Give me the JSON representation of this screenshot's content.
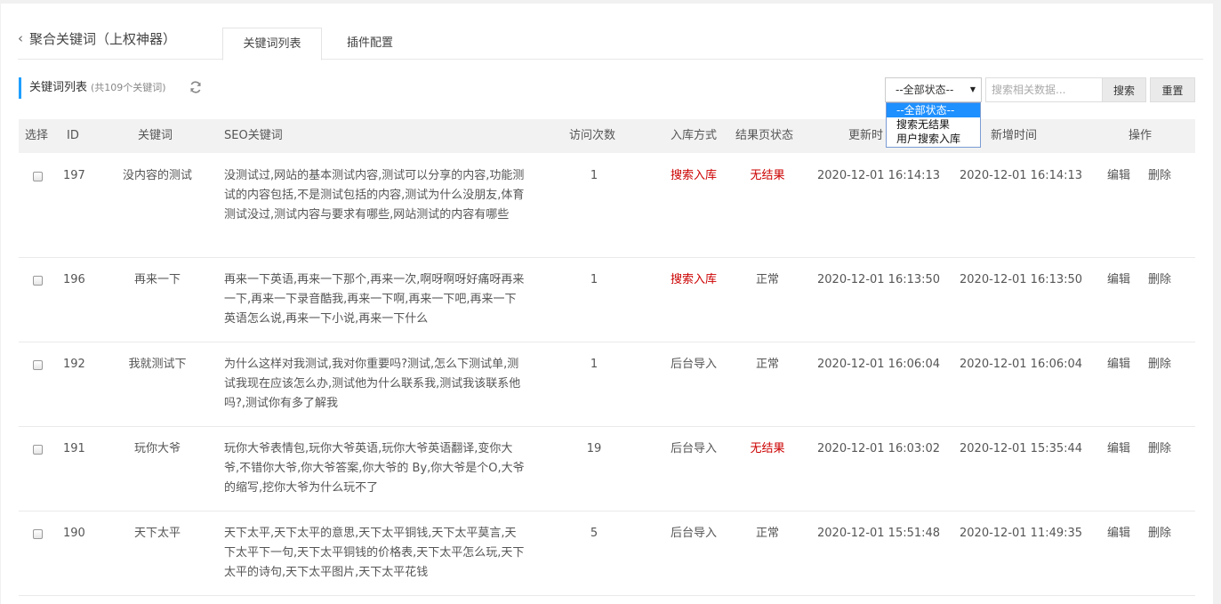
{
  "header": {
    "back_title": "聚合关键词（上权神器）",
    "tabs": [
      {
        "label": "关键词列表",
        "active": true
      },
      {
        "label": "插件配置",
        "active": false
      }
    ]
  },
  "toolbar": {
    "section_title": "关键词列表",
    "section_count": "(共109个关键词)",
    "status_select_value": "--全部状态--",
    "status_options": [
      "--全部状态--",
      "搜索无结果",
      "用户搜索入库"
    ],
    "search_placeholder": "搜索相关数据...",
    "search_label": "搜索",
    "reset_label": "重置"
  },
  "table": {
    "columns": [
      "选择",
      "ID",
      "关键词",
      "SEO关键词",
      "访问次数",
      "入库方式",
      "结果页状态",
      "更新时",
      "新增时间",
      "操作"
    ],
    "edit_label": "编辑",
    "delete_label": "删除",
    "rows": [
      {
        "id": "197",
        "keyword": "没内容的测试",
        "seo": "没测试过,网站的基本测试内容,测试可以分享的内容,功能测试的内容包括,不是测试包括的内容,测试为什么没朋友,体育测试没过,测试内容与要求有哪些,网站测试的内容有哪些",
        "visits": "1",
        "source": "搜索入库",
        "status": "无结果",
        "updated": "2020-12-01 16:14:13",
        "created": "2020-12-01 16:14:13"
      },
      {
        "id": "196",
        "keyword": "再来一下",
        "seo": "再来一下英语,再来一下那个,再来一次,啊呀啊呀好痛呀再来一下,再来一下录音酷我,再来一下啊,再来一下吧,再来一下英语怎么说,再来一下小说,再来一下什么",
        "visits": "1",
        "source": "搜索入库",
        "status": "正常",
        "updated": "2020-12-01 16:13:50",
        "created": "2020-12-01 16:13:50"
      },
      {
        "id": "192",
        "keyword": "我就测试下",
        "seo": "为什么这样对我测试,我对你重要吗?测试,怎么下测试单,测试我现在应该怎么办,测试他为什么联系我,测试我该联系他吗?,测试你有多了解我",
        "visits": "1",
        "source": "后台导入",
        "status": "正常",
        "updated": "2020-12-01 16:06:04",
        "created": "2020-12-01 16:06:04"
      },
      {
        "id": "191",
        "keyword": "玩你大爷",
        "seo": "玩你大爷表情包,玩你大爷英语,玩你大爷英语翻译,变你大爷,不错你大爷,你大爷答案,你大爷的 By,你大爷是个O,大爷的缩写,挖你大爷为什么玩不了",
        "visits": "19",
        "source": "后台导入",
        "status": "无结果",
        "updated": "2020-12-01 16:03:02",
        "created": "2020-12-01 15:35:44"
      },
      {
        "id": "190",
        "keyword": "天下太平",
        "seo": "天下太平,天下太平的意思,天下太平铜钱,天下太平莫言,天下太平下一句,天下太平铜钱的价格表,天下太平怎么玩,天下太平的诗句,天下太平图片,天下太平花钱",
        "visits": "5",
        "source": "后台导入",
        "status": "正常",
        "updated": "2020-12-01 15:51:48",
        "created": "2020-12-01 11:49:35"
      }
    ]
  },
  "colors": {
    "accent": "#1e9fff",
    "red": "#cc0000",
    "keyword_link": "#1f4e8c"
  }
}
